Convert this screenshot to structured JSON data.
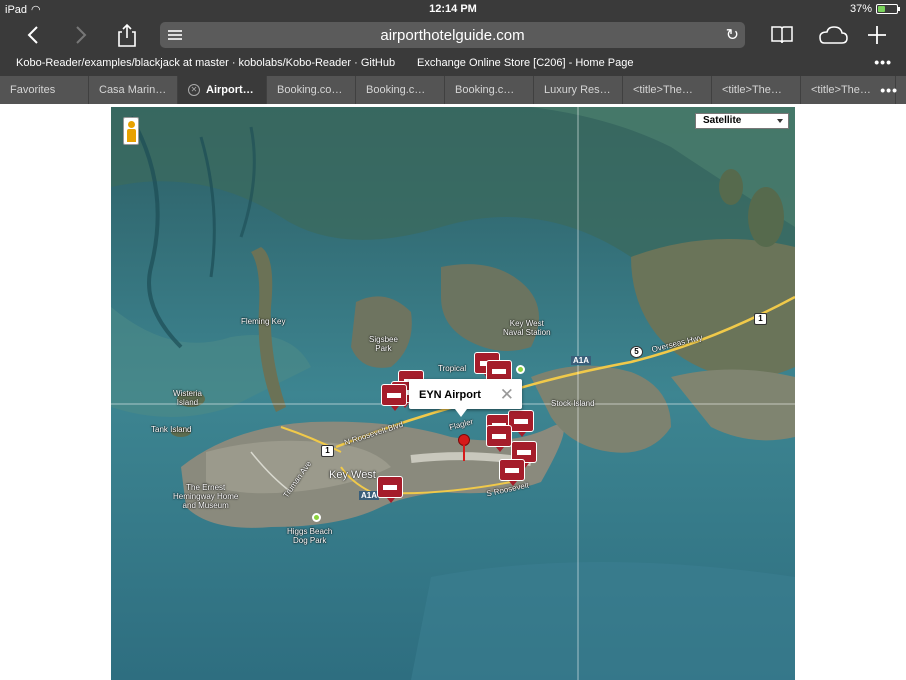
{
  "status": {
    "device": "iPad",
    "time": "12:14 PM",
    "battery": "37%",
    "battery_level": 0.37
  },
  "toolbar": {
    "url": "airporthotelguide.com"
  },
  "bookmarks": [
    "Kobo-Reader/examples/blackjack at master · kobolabs/Kobo-Reader · GitHub",
    "Exchange Online Store [C206] - Home Page"
  ],
  "tabs": [
    {
      "label": "Favorites",
      "active": false
    },
    {
      "label": "Casa Marin…",
      "active": false
    },
    {
      "label": "Airport…",
      "active": true
    },
    {
      "label": "Booking.co…",
      "active": false
    },
    {
      "label": "Booking.c…",
      "active": false
    },
    {
      "label": "Booking.c…",
      "active": false
    },
    {
      "label": "Luxury Res…",
      "active": false
    },
    {
      "label": "<title>The…",
      "active": false
    },
    {
      "label": "<title>The…",
      "active": false
    },
    {
      "label": "<title>The…",
      "active": false
    }
  ],
  "map": {
    "map_type": "Satellite",
    "infowindow_title": "EYN Airport",
    "labels": {
      "fleming_key": "Fleming Key",
      "sigsbee_park": "Sigsbee\nPark",
      "key_west_naval_station": "Key West\nNaval Station",
      "tropical": "Tropical",
      "wisteria_island": "Wisteria\nIsland",
      "tank_island": "Tank Island",
      "stock_island": "Stock Island",
      "key_west": "Key West",
      "truman_ave": "Truman Ave",
      "roosevelt": "N Roosevelt Blvd",
      "flagler": "Flagler",
      "s_roosevelt": "S Roosevelt",
      "overseas_hwy": "Overseas Hwy",
      "hemingway": "The Ernest\nHemingway Home\nand Museum",
      "higgs_beach": "Higgs Beach\nDog Park",
      "route_1": "1",
      "route_5": "5",
      "a1a": "A1A"
    },
    "colors": {
      "water": "#2f6f7c",
      "land": "#5b6b4e",
      "hotel_marker": "#a51d2b"
    }
  }
}
